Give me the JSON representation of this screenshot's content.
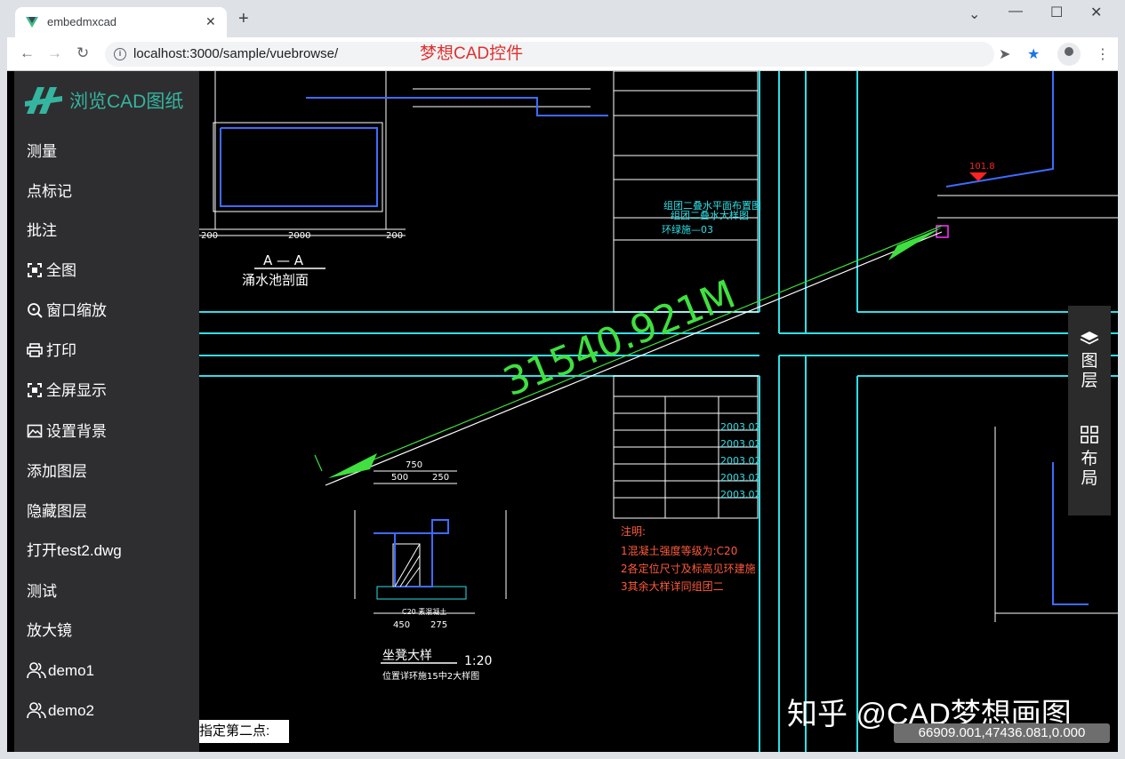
{
  "browser": {
    "tab_title": "embedmxcad",
    "tab_close": "✕",
    "new_tab": "+",
    "url": "localhost:3000/sample/vuebrowse/",
    "overlay_title": "梦想CAD控件",
    "accent": "#1a73e8"
  },
  "sidebar": {
    "brand": "浏览CAD图纸",
    "brand_color": "#35b5a0",
    "items": [
      {
        "label": "测量",
        "icon": ""
      },
      {
        "label": "点标记",
        "icon": ""
      },
      {
        "label": "批注",
        "icon": ""
      },
      {
        "label": "全图",
        "icon": "fullview-icon"
      },
      {
        "label": "窗口缩放",
        "icon": "zoom-window-icon"
      },
      {
        "label": "打印",
        "icon": "printer-icon"
      },
      {
        "label": "全屏显示",
        "icon": "fullscreen-icon"
      },
      {
        "label": "设置背景",
        "icon": "image-icon"
      },
      {
        "label": "添加图层",
        "icon": ""
      },
      {
        "label": "隐藏图层",
        "icon": ""
      },
      {
        "label": "打开test2.dwg",
        "icon": ""
      },
      {
        "label": "测试",
        "icon": ""
      },
      {
        "label": "放大镜",
        "icon": ""
      },
      {
        "label": "demo1",
        "icon": "users-icon"
      },
      {
        "label": "demo2",
        "icon": "users-icon"
      }
    ]
  },
  "right_panel": {
    "layers_label": "图层",
    "layout_label": "布局"
  },
  "cad": {
    "measurement": "31540.921M",
    "section_title": "A — A",
    "section_subtitle": "涌水池剖面",
    "detail_title": "坐凳大样",
    "detail_scale": "1:20",
    "detail_note": "位置详环施15中2大样图",
    "notes_title": "注明:",
    "note1": "1混凝土强度等级为:C20",
    "note2": "2各定位尺寸及标高见环建施",
    "note3": "3其余大样详同组团二",
    "title_drawing_name": "组团二叠水平面布置图",
    "title_drawing_name2": "组团二叠水大样图",
    "title_drawing_no": "环绿施—03",
    "date_value": "2003.02",
    "dim_2000": "2000",
    "dim_200": "200",
    "dim_750": "750",
    "dim_500": "500",
    "dim_250": "250",
    "dim_450": "450",
    "dim_275": "275",
    "level_value": "101.8",
    "concrete_label": "C20 素混凝土"
  },
  "status": {
    "prompt": "指定第二点:",
    "watermark": "知乎 @CAD梦想画图",
    "coordinates": "66909.001,47436.081,0.000"
  }
}
